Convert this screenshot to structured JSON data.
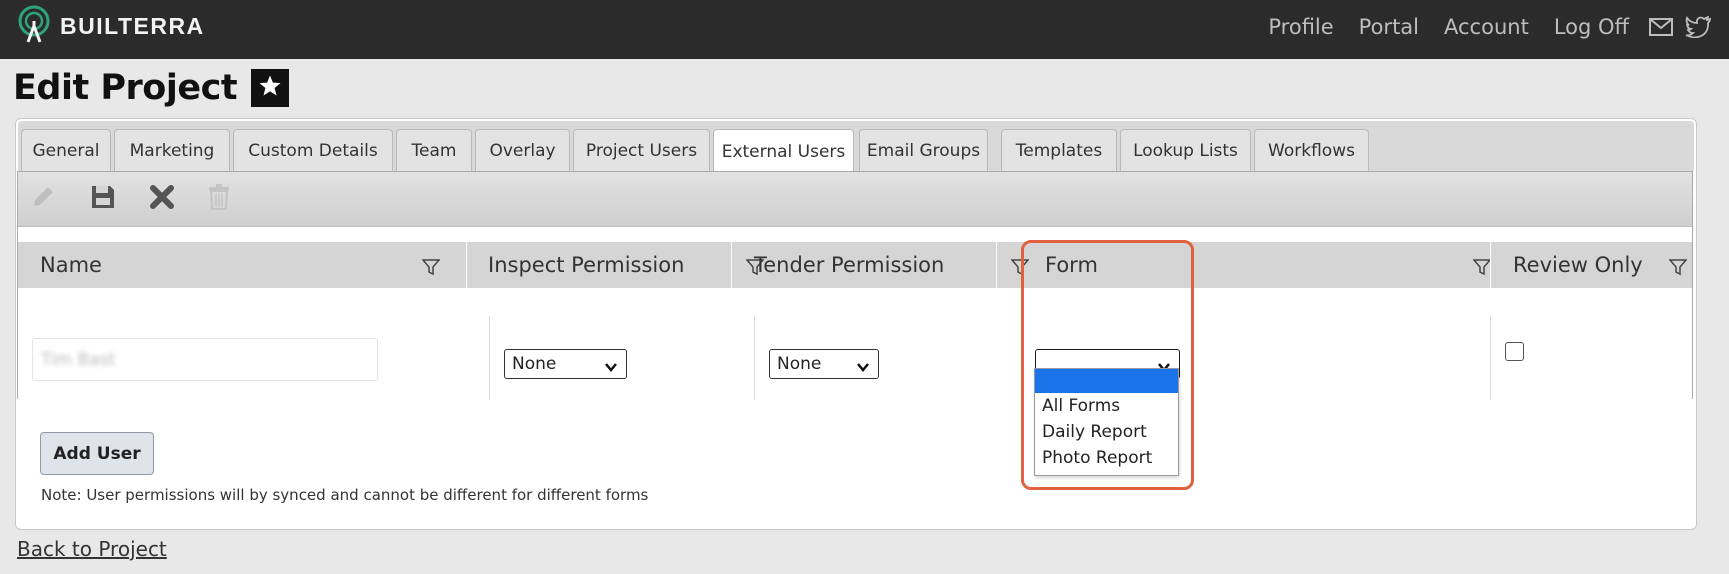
{
  "header": {
    "brand": "BUILTERRA",
    "nav": [
      "Profile",
      "Portal",
      "Account",
      "Log Off"
    ],
    "icons": [
      "mail-icon",
      "twitter-icon"
    ]
  },
  "page": {
    "title": "Edit Project"
  },
  "tabs": [
    {
      "label": "General",
      "active": false
    },
    {
      "label": "Marketing",
      "active": false
    },
    {
      "label": "Custom Details",
      "active": false
    },
    {
      "label": "Team",
      "active": false
    },
    {
      "label": "Overlay",
      "active": false
    },
    {
      "label": "Project Users",
      "active": false
    },
    {
      "label": "External Users",
      "active": true
    },
    {
      "label": "Email Groups",
      "active": false
    },
    {
      "label": "Templates",
      "active": false
    },
    {
      "label": "Lookup Lists",
      "active": false
    },
    {
      "label": "Workflows",
      "active": false
    }
  ],
  "toolbar": {
    "icons": [
      "edit-icon",
      "save-icon",
      "cancel-icon",
      "delete-icon"
    ]
  },
  "grid": {
    "columns": [
      "Name",
      "Inspect Permission",
      "Tender Permission",
      "Form",
      "Review Only"
    ],
    "row": {
      "name": "Tim Bast",
      "inspect_permission": "None",
      "tender_permission": "None",
      "form": "",
      "review_only": false
    }
  },
  "form_dropdown": {
    "options": [
      "",
      "All Forms",
      "Daily Report",
      "Photo Report"
    ],
    "selected_index": 0
  },
  "actions": {
    "add_user": "Add User",
    "note": "Note: User permissions will by synced and cannot be different for different forms",
    "back_link": "Back to Project"
  },
  "colors": {
    "topbar": "#2b2b2b",
    "highlight": "#e06040",
    "dropdown_selected": "#1a73e8"
  }
}
